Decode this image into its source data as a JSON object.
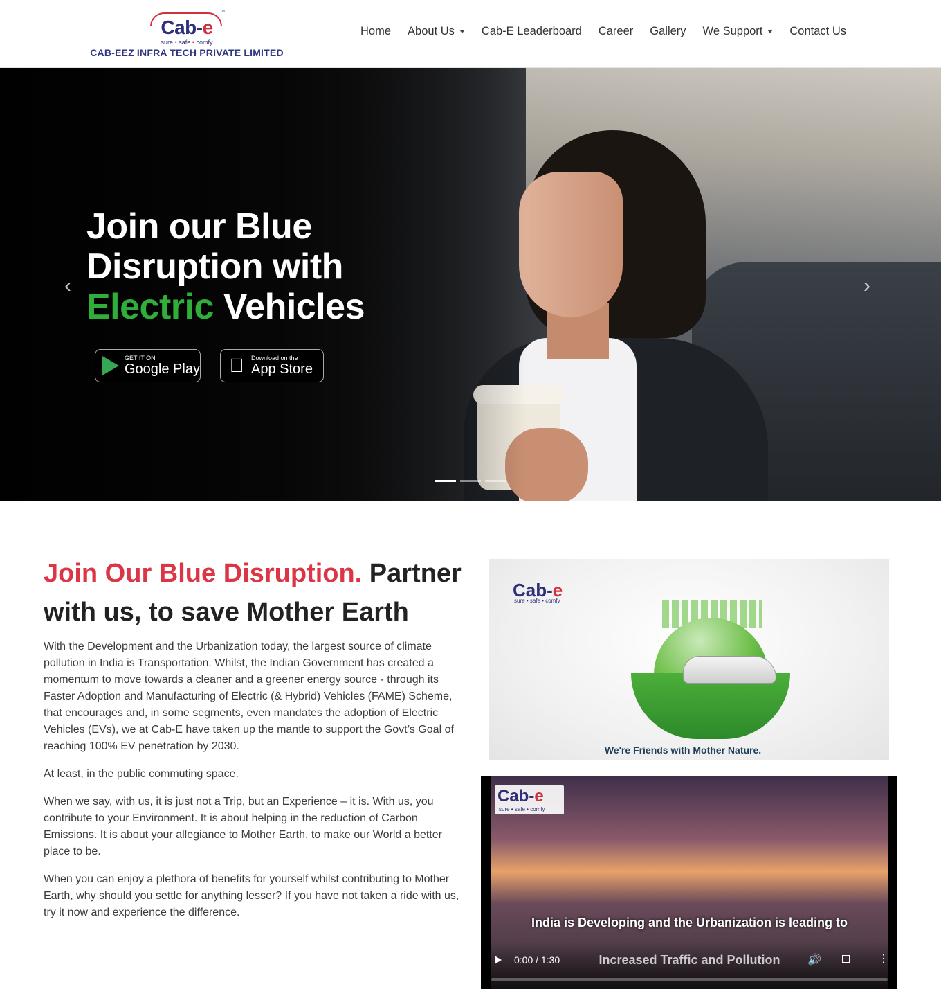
{
  "brand": {
    "logo_main": "Cab-",
    "logo_accent": "e",
    "tagline": [
      "sure",
      "safe",
      "comfy"
    ],
    "tm": "™",
    "company": "CAB-EEZ INFRA TECH PRIVATE LIMITED"
  },
  "nav": {
    "items": [
      {
        "label": "Home",
        "has_dropdown": false
      },
      {
        "label": "About Us",
        "has_dropdown": true
      },
      {
        "label": "Cab-E Leaderboard",
        "has_dropdown": false
      },
      {
        "label": "Career",
        "has_dropdown": false
      },
      {
        "label": "Gallery",
        "has_dropdown": false
      },
      {
        "label": "We Support",
        "has_dropdown": true
      },
      {
        "label": "Contact Us",
        "has_dropdown": false
      }
    ]
  },
  "hero": {
    "line1": "Join our Blue",
    "line2": "Disruption with",
    "line3_accent": "Electric",
    "line3_rest": " Vehicles",
    "google_play": {
      "small": "GET IT ON",
      "big": "Google Play"
    },
    "app_store": {
      "small": "Download on the",
      "big": "App Store"
    },
    "prev_arrow": "‹",
    "next_arrow": "›",
    "slide_count": 3,
    "active_slide": 0
  },
  "section": {
    "title_accent": "Join Our Blue Disruption.",
    "title_rest": " Partner with us, to save Mother Earth",
    "paragraphs": [
      "With the Development and the Urbanization today, the largest source of climate pollution in India is Transportation. Whilst, the Indian Government has created a momentum to move towards a cleaner and a greener energy source - through its Faster Adoption and Manufacturing of Electric (& Hybrid) Vehicles (FAME) Scheme, that encourages and, in some segments, even mandates the adoption of Electric Vehicles (EVs), we at Cab-E have taken up the mantle to support the Govt’s Goal of reaching 100% EV penetration by 2030.",
      "At least, in the public commuting space.",
      "When we say, with us, it is just not a Trip, but an Experience – it is. With us, you contribute to your Environment. It is about helping in the reduction of Carbon Emissions. It is about your allegiance to Mother Earth, to make our World a better place to be.",
      "When you can enjoy a plethora of benefits for yourself whilst contributing to Mother Earth, why should you settle for anything lesser? If you have not taken a ride with us, try it now and experience the difference."
    ]
  },
  "image_card": {
    "caption": "We're Friends with Mother Nature."
  },
  "video": {
    "subtitle_line1": "India is Developing and the Urbanization is leading to",
    "subtitle_line2": "Increased Traffic and Pollution",
    "time": "0:00 / 1:30",
    "progress": 0,
    "volume_icon": "🔊",
    "more_icon": "⋮"
  }
}
